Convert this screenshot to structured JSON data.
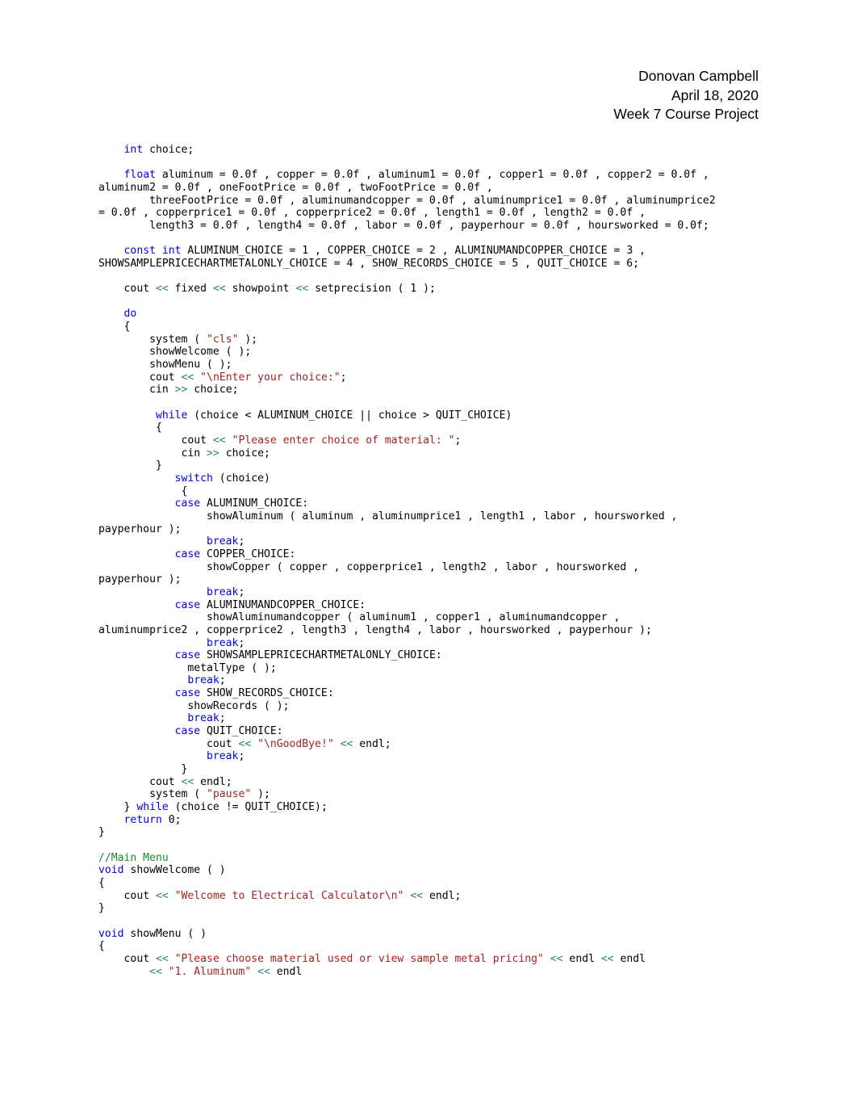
{
  "document": {
    "header": {
      "author": "Donovan Campbell",
      "date": "April 18, 2020",
      "assignment": "Week 7 Course Project"
    },
    "language": "cpp",
    "code_lines": [
      {
        "indent": 4,
        "tokens": [
          {
            "t": "kw",
            "v": "int"
          },
          {
            "t": "pln",
            "v": " choice;"
          }
        ]
      },
      {
        "blank": true
      },
      {
        "indent": 4,
        "tokens": [
          {
            "t": "kw",
            "v": "float"
          },
          {
            "t": "pln",
            "v": " aluminum = 0.0f , copper = 0.0f , aluminum1 = 0.0f , copper1 = 0.0f , copper2 = 0.0f ,"
          }
        ]
      },
      {
        "indent": 0,
        "tokens": [
          {
            "t": "pln",
            "v": "aluminum2 = 0.0f , oneFootPrice = 0.0f , twoFootPrice = 0.0f ,"
          }
        ]
      },
      {
        "indent": 8,
        "tokens": [
          {
            "t": "pln",
            "v": "threeFootPrice = 0.0f , aluminumandcopper = 0.0f , aluminumprice1 = 0.0f , aluminumprice2"
          }
        ]
      },
      {
        "indent": 0,
        "tokens": [
          {
            "t": "pln",
            "v": "= 0.0f , copperprice1 = 0.0f , copperprice2 = 0.0f , length1 = 0.0f , length2 = 0.0f ,"
          }
        ]
      },
      {
        "indent": 8,
        "tokens": [
          {
            "t": "pln",
            "v": "length3 = 0.0f , length4 = 0.0f , labor = 0.0f , payperhour = 0.0f , hoursworked = 0.0f;"
          }
        ]
      },
      {
        "blank": true
      },
      {
        "indent": 4,
        "tokens": [
          {
            "t": "kw",
            "v": "const int"
          },
          {
            "t": "pln",
            "v": " ALUMINUM_CHOICE = 1 , COPPER_CHOICE = 2 , ALUMINUMANDCOPPER_CHOICE = 3 ,"
          }
        ]
      },
      {
        "indent": 0,
        "tokens": [
          {
            "t": "pln",
            "v": "SHOWSAMPLEPRICECHARTMETALONLY_CHOICE = 4 , SHOW_RECORDS_CHOICE = 5 , QUIT_CHOICE = 6;"
          }
        ]
      },
      {
        "blank": true
      },
      {
        "indent": 4,
        "tokens": [
          {
            "t": "pln",
            "v": "cout "
          },
          {
            "t": "op",
            "v": "<<"
          },
          {
            "t": "pln",
            "v": " fixed "
          },
          {
            "t": "op",
            "v": "<<"
          },
          {
            "t": "pln",
            "v": " showpoint "
          },
          {
            "t": "op",
            "v": "<<"
          },
          {
            "t": "pln",
            "v": " setprecision ( 1 );"
          }
        ]
      },
      {
        "blank": true
      },
      {
        "indent": 4,
        "tokens": [
          {
            "t": "kw",
            "v": "do"
          }
        ]
      },
      {
        "indent": 4,
        "tokens": [
          {
            "t": "pln",
            "v": "{"
          }
        ]
      },
      {
        "indent": 8,
        "tokens": [
          {
            "t": "pln",
            "v": "system ( "
          },
          {
            "t": "str",
            "v": "\"cls\""
          },
          {
            "t": "pln",
            "v": " );"
          }
        ]
      },
      {
        "indent": 8,
        "tokens": [
          {
            "t": "pln",
            "v": "showWelcome ( );"
          }
        ]
      },
      {
        "indent": 8,
        "tokens": [
          {
            "t": "pln",
            "v": "showMenu ( );"
          }
        ]
      },
      {
        "indent": 8,
        "tokens": [
          {
            "t": "pln",
            "v": "cout "
          },
          {
            "t": "op",
            "v": "<<"
          },
          {
            "t": "pln",
            "v": " "
          },
          {
            "t": "str",
            "v": "\"\\nEnter your choice:\""
          },
          {
            "t": "pln",
            "v": ";"
          }
        ]
      },
      {
        "indent": 8,
        "tokens": [
          {
            "t": "pln",
            "v": "cin "
          },
          {
            "t": "op",
            "v": ">>"
          },
          {
            "t": "pln",
            "v": " choice;"
          }
        ]
      },
      {
        "blank": true
      },
      {
        "indent": 9,
        "tokens": [
          {
            "t": "kw",
            "v": "while"
          },
          {
            "t": "pln",
            "v": " (choice < ALUMINUM_CHOICE || choice > QUIT_CHOICE)"
          }
        ]
      },
      {
        "indent": 9,
        "tokens": [
          {
            "t": "pln",
            "v": "{"
          }
        ]
      },
      {
        "indent": 13,
        "tokens": [
          {
            "t": "pln",
            "v": "cout "
          },
          {
            "t": "op",
            "v": "<<"
          },
          {
            "t": "pln",
            "v": " "
          },
          {
            "t": "str",
            "v": "\"Please enter choice of material: \""
          },
          {
            "t": "pln",
            "v": ";"
          }
        ]
      },
      {
        "indent": 13,
        "tokens": [
          {
            "t": "pln",
            "v": "cin "
          },
          {
            "t": "op",
            "v": ">>"
          },
          {
            "t": "pln",
            "v": " choice;"
          }
        ]
      },
      {
        "indent": 9,
        "tokens": [
          {
            "t": "pln",
            "v": "}"
          }
        ]
      },
      {
        "indent": 12,
        "tokens": [
          {
            "t": "kw",
            "v": "switch"
          },
          {
            "t": "pln",
            "v": " (choice)"
          }
        ]
      },
      {
        "indent": 13,
        "tokens": [
          {
            "t": "pln",
            "v": "{"
          }
        ]
      },
      {
        "indent": 12,
        "tokens": [
          {
            "t": "kw",
            "v": "case"
          },
          {
            "t": "pln",
            "v": " ALUMINUM_CHOICE:"
          }
        ]
      },
      {
        "indent": 17,
        "tokens": [
          {
            "t": "pln",
            "v": "showAluminum ( aluminum , aluminumprice1 , length1 , labor , hoursworked ,"
          }
        ]
      },
      {
        "indent": 0,
        "tokens": [
          {
            "t": "pln",
            "v": "payperhour );"
          }
        ]
      },
      {
        "indent": 17,
        "tokens": [
          {
            "t": "kw",
            "v": "break"
          },
          {
            "t": "pln",
            "v": ";"
          }
        ]
      },
      {
        "indent": 12,
        "tokens": [
          {
            "t": "kw",
            "v": "case"
          },
          {
            "t": "pln",
            "v": " COPPER_CHOICE:"
          }
        ]
      },
      {
        "indent": 17,
        "tokens": [
          {
            "t": "pln",
            "v": "showCopper ( copper , copperprice1 , length2 , labor , hoursworked ,"
          }
        ]
      },
      {
        "indent": 0,
        "tokens": [
          {
            "t": "pln",
            "v": "payperhour );"
          }
        ]
      },
      {
        "indent": 17,
        "tokens": [
          {
            "t": "kw",
            "v": "break"
          },
          {
            "t": "pln",
            "v": ";"
          }
        ]
      },
      {
        "indent": 12,
        "tokens": [
          {
            "t": "kw",
            "v": "case"
          },
          {
            "t": "pln",
            "v": " ALUMINUMANDCOPPER_CHOICE:"
          }
        ]
      },
      {
        "indent": 17,
        "tokens": [
          {
            "t": "pln",
            "v": "showAluminumandcopper ( aluminum1 , copper1 , aluminumandcopper ,"
          }
        ]
      },
      {
        "indent": 0,
        "tokens": [
          {
            "t": "pln",
            "v": "aluminumprice2 , copperprice2 , length3 , length4 , labor , hoursworked , payperhour );"
          }
        ]
      },
      {
        "indent": 17,
        "tokens": [
          {
            "t": "kw",
            "v": "break"
          },
          {
            "t": "pln",
            "v": ";"
          }
        ]
      },
      {
        "indent": 12,
        "tokens": [
          {
            "t": "kw",
            "v": "case"
          },
          {
            "t": "pln",
            "v": " SHOWSAMPLEPRICECHARTMETALONLY_CHOICE:"
          }
        ]
      },
      {
        "indent": 14,
        "tokens": [
          {
            "t": "pln",
            "v": "metalType ( );"
          }
        ]
      },
      {
        "indent": 14,
        "tokens": [
          {
            "t": "kw",
            "v": "break"
          },
          {
            "t": "pln",
            "v": ";"
          }
        ]
      },
      {
        "indent": 12,
        "tokens": [
          {
            "t": "kw",
            "v": "case"
          },
          {
            "t": "pln",
            "v": " SHOW_RECORDS_CHOICE:"
          }
        ]
      },
      {
        "indent": 14,
        "tokens": [
          {
            "t": "pln",
            "v": "showRecords ( );"
          }
        ]
      },
      {
        "indent": 14,
        "tokens": [
          {
            "t": "kw",
            "v": "break"
          },
          {
            "t": "pln",
            "v": ";"
          }
        ]
      },
      {
        "indent": 12,
        "tokens": [
          {
            "t": "kw",
            "v": "case"
          },
          {
            "t": "pln",
            "v": " QUIT_CHOICE:"
          }
        ]
      },
      {
        "indent": 17,
        "tokens": [
          {
            "t": "pln",
            "v": "cout "
          },
          {
            "t": "op",
            "v": "<<"
          },
          {
            "t": "pln",
            "v": " "
          },
          {
            "t": "str",
            "v": "\"\\nGoodBye!\""
          },
          {
            "t": "pln",
            "v": " "
          },
          {
            "t": "op",
            "v": "<<"
          },
          {
            "t": "pln",
            "v": " endl;"
          }
        ]
      },
      {
        "indent": 17,
        "tokens": [
          {
            "t": "kw",
            "v": "break"
          },
          {
            "t": "pln",
            "v": ";"
          }
        ]
      },
      {
        "indent": 13,
        "tokens": [
          {
            "t": "pln",
            "v": "}"
          }
        ]
      },
      {
        "indent": 8,
        "tokens": [
          {
            "t": "pln",
            "v": "cout "
          },
          {
            "t": "op",
            "v": "<<"
          },
          {
            "t": "pln",
            "v": " endl;"
          }
        ]
      },
      {
        "indent": 8,
        "tokens": [
          {
            "t": "pln",
            "v": "system ( "
          },
          {
            "t": "str",
            "v": "\"pause\""
          },
          {
            "t": "pln",
            "v": " );"
          }
        ]
      },
      {
        "indent": 4,
        "tokens": [
          {
            "t": "pln",
            "v": "} "
          },
          {
            "t": "kw",
            "v": "while"
          },
          {
            "t": "pln",
            "v": " (choice != QUIT_CHOICE);"
          }
        ]
      },
      {
        "indent": 4,
        "tokens": [
          {
            "t": "kw",
            "v": "return"
          },
          {
            "t": "pln",
            "v": " 0;"
          }
        ]
      },
      {
        "indent": 0,
        "tokens": [
          {
            "t": "pln",
            "v": "}"
          }
        ]
      },
      {
        "blank": true
      },
      {
        "indent": 0,
        "tokens": [
          {
            "t": "cmt",
            "v": "//Main Menu"
          }
        ]
      },
      {
        "indent": 0,
        "tokens": [
          {
            "t": "kw",
            "v": "void"
          },
          {
            "t": "pln",
            "v": " showWelcome ( )"
          }
        ]
      },
      {
        "indent": 0,
        "tokens": [
          {
            "t": "pln",
            "v": "{"
          }
        ]
      },
      {
        "indent": 4,
        "tokens": [
          {
            "t": "pln",
            "v": "cout "
          },
          {
            "t": "op",
            "v": "<<"
          },
          {
            "t": "pln",
            "v": " "
          },
          {
            "t": "str",
            "v": "\"Welcome to Electrical Calculator\\n\""
          },
          {
            "t": "pln",
            "v": " "
          },
          {
            "t": "op",
            "v": "<<"
          },
          {
            "t": "pln",
            "v": " endl;"
          }
        ]
      },
      {
        "indent": 0,
        "tokens": [
          {
            "t": "pln",
            "v": "}"
          }
        ]
      },
      {
        "blank": true
      },
      {
        "indent": 0,
        "tokens": [
          {
            "t": "kw",
            "v": "void"
          },
          {
            "t": "pln",
            "v": " showMenu ( )"
          }
        ]
      },
      {
        "indent": 0,
        "tokens": [
          {
            "t": "pln",
            "v": "{"
          }
        ]
      },
      {
        "indent": 4,
        "tokens": [
          {
            "t": "pln",
            "v": "cout "
          },
          {
            "t": "op",
            "v": "<<"
          },
          {
            "t": "pln",
            "v": " "
          },
          {
            "t": "str",
            "v": "\"Please choose material used or view sample metal pricing\""
          },
          {
            "t": "pln",
            "v": " "
          },
          {
            "t": "op",
            "v": "<<"
          },
          {
            "t": "pln",
            "v": " endl "
          },
          {
            "t": "op",
            "v": "<<"
          },
          {
            "t": "pln",
            "v": " endl"
          }
        ]
      },
      {
        "indent": 8,
        "tokens": [
          {
            "t": "op",
            "v": "<<"
          },
          {
            "t": "pln",
            "v": " "
          },
          {
            "t": "str",
            "v": "\"1. Aluminum\""
          },
          {
            "t": "pln",
            "v": " "
          },
          {
            "t": "op",
            "v": "<<"
          },
          {
            "t": "pln",
            "v": " endl"
          }
        ]
      }
    ],
    "colors": {
      "keyword": "#0000E6",
      "string": "#A52222",
      "operator": "#28827F",
      "comment": "#1A8A2E",
      "text": "#000000",
      "background": "#FFFFFF"
    }
  }
}
